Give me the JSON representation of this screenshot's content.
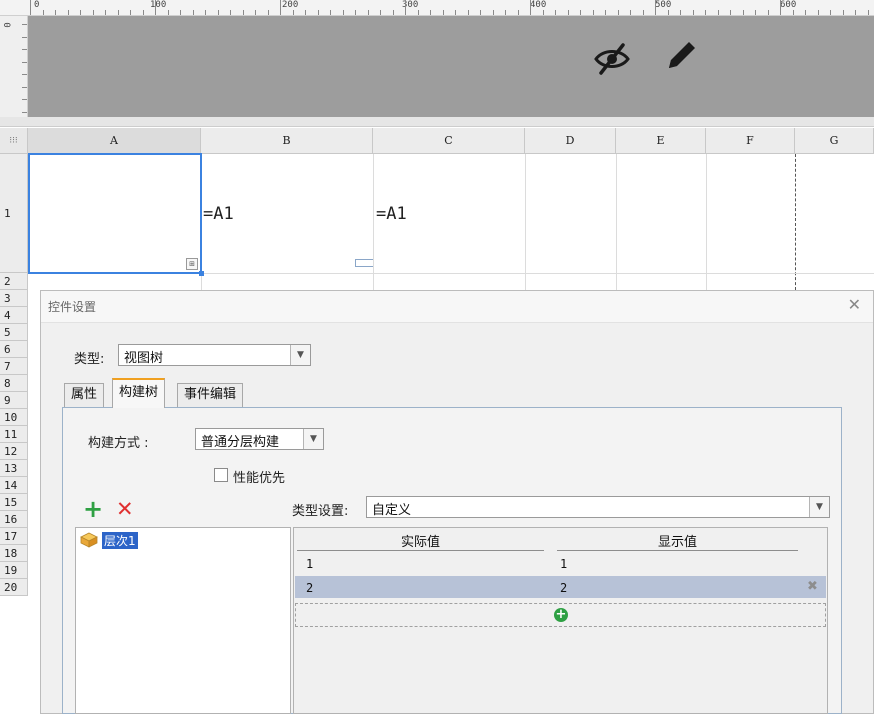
{
  "ruler": {
    "labels": [
      "0",
      "100",
      "200",
      "300",
      "400",
      "500",
      "600"
    ],
    "left_label": "0"
  },
  "header_icons": [
    "eye-off-icon",
    "pencil-icon"
  ],
  "grid": {
    "columns": [
      "A",
      "B",
      "C",
      "D",
      "E",
      "F",
      "G"
    ],
    "rows": [
      "1",
      "2",
      "3",
      "4",
      "5",
      "6",
      "7",
      "8",
      "9",
      "10",
      "11",
      "12",
      "13",
      "14",
      "15",
      "16",
      "17",
      "18",
      "19",
      "20"
    ],
    "cells": {
      "B1": "=A1",
      "C1": "=A1"
    },
    "selected_cell": "A1"
  },
  "dialog": {
    "title": "控件设置",
    "type_label": "类型:",
    "type_value": "视图树",
    "tabs": [
      "属性",
      "构建树",
      "事件编辑"
    ],
    "active_tab": "构建树",
    "build_method_label": "构建方式 :",
    "build_method_value": "普通分层构建",
    "performance_first_label": "性能优先",
    "performance_first_checked": false,
    "type_setting_label": "类型设置:",
    "type_setting_value": "自定义",
    "levels": [
      "层次1"
    ],
    "table": {
      "headers": [
        "实际值",
        "显示值"
      ],
      "rows": [
        {
          "actual": "1",
          "display": "1"
        },
        {
          "actual": "2",
          "display": "2"
        }
      ]
    }
  },
  "colors": {
    "accent": "#2c64c8",
    "selection_border": "#3b82e0",
    "tab_highlight": "#f0a020",
    "add_green": "#2ea043",
    "delete_red": "#e03030"
  }
}
